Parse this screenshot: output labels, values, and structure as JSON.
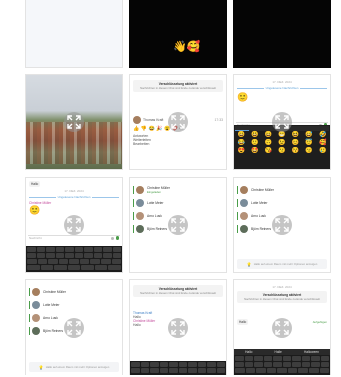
{
  "grid": {
    "row0": {
      "cell2_emoji": "👋🥰"
    },
    "cell_r1c2": {
      "banner_title": "Verschlüsselung aktiviert",
      "banner_sub": "Nachrichten in diesem Chat sind Ende-zu-Ende verschlüsselt",
      "sender": "Thomas Kraft",
      "time": "17:33",
      "reactions": [
        "👍",
        "👎",
        "😂",
        "🎉",
        "😮",
        "❤️",
        "👀"
      ],
      "menu_items": [
        "Antworten",
        "Weiterleiten",
        "Bearbeiten"
      ]
    },
    "cell_r1c3": {
      "date": "17. DEZ. 2024",
      "unread": "Ungelesene Nachrichten",
      "composer_placeholder": "Nachricht",
      "emoji_grid": [
        "😀",
        "😃",
        "😄",
        "😁",
        "😆",
        "😅",
        "🤣",
        "😂",
        "🙂",
        "🙃",
        "😉",
        "😊",
        "😇",
        "🥰",
        "😍",
        "🤩",
        "😘",
        "😗",
        "😚",
        "😙",
        "🥲"
      ]
    },
    "cell_r2c1": {
      "hello": "Hallo",
      "date": "17. DEZ. 2024",
      "unread": "Ungelesene Nachrichten",
      "sender": "Christine Müller",
      "emoji": "🙂",
      "composer_placeholder": "Nachricht"
    },
    "members": [
      {
        "name": "Christine Müller",
        "sub": "Eingeladen"
      },
      {
        "name": "Lotte Meier",
        "sub": ""
      },
      {
        "name": "Arno Lusk",
        "sub": ""
      },
      {
        "name": "Björn Reiners",
        "sub": ""
      }
    ],
    "cell_r2c3_footer": "Hallo auf einem Raum mit mehr Optionen anzeigen",
    "cell_r3c2": {
      "banner_title": "Verschlüsselung aktiviert",
      "banner_sub": "Nachrichten in diesem Chat sind Ende-zu-Ende verschlüsselt",
      "sender1": "Thomas Kraft",
      "msg1": "Hallo",
      "sender2": "Christine Müller",
      "msg2": "Hallo"
    },
    "cell_r3c3": {
      "date": "17. DEZ. 2024",
      "banner_title": "Verschlüsselung aktiviert",
      "banner_sub": "Nachrichten in diesem Chat sind Ende-zu-Ende verschlüsselt",
      "bubble": "Hallo",
      "status": "Aufgefügen",
      "suggestions": [
        "Hallo",
        "Halle",
        "Halloween"
      ]
    }
  }
}
